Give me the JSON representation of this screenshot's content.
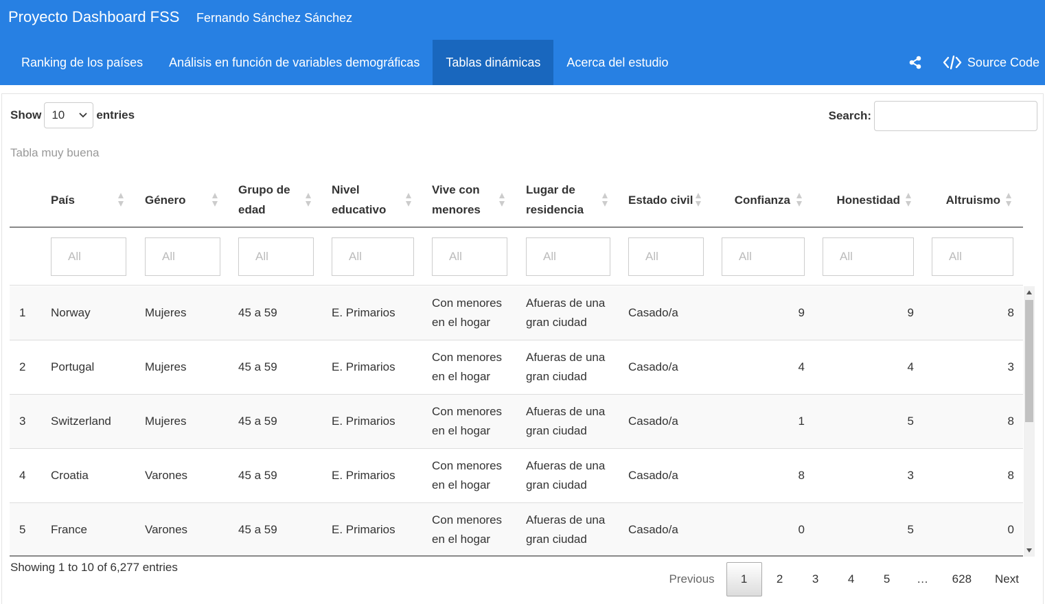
{
  "header": {
    "brand": "Proyecto Dashboard FSS",
    "author": "Fernando Sánchez Sánchez",
    "tabs": [
      {
        "label": "Ranking de los países",
        "active": false
      },
      {
        "label": "Análisis en función de variables demográficas",
        "active": false
      },
      {
        "label": "Tablas dinámicas",
        "active": true
      },
      {
        "label": "Acerca del estudio",
        "active": false
      }
    ],
    "source_code_label": "Source Code"
  },
  "controls": {
    "show_label": "Show",
    "entries_label": "entries",
    "page_length": "10",
    "search_label": "Search:",
    "search_value": ""
  },
  "caption": "Tabla muy buena",
  "table": {
    "columns": [
      "País",
      "Género",
      "Grupo de edad",
      "Nivel educativo",
      "Vive con menores",
      "Lugar de residencia",
      "Estado civil",
      "Confianza",
      "Honestidad",
      "Altruismo"
    ],
    "filter_placeholders": [
      "All",
      "All",
      "All",
      "All",
      "All",
      "All",
      "All",
      "All",
      "All",
      "All"
    ],
    "rows": [
      {
        "index": "1",
        "pais": "Norway",
        "genero": "Mujeres",
        "edad": "45 a 59",
        "nivel": "E. Primarios",
        "menores": "Con menores en el hogar",
        "residencia": "Afueras de una gran ciudad",
        "civil": "Casado/a",
        "confianza": "9",
        "honestidad": "9",
        "altruismo": "8"
      },
      {
        "index": "2",
        "pais": "Portugal",
        "genero": "Mujeres",
        "edad": "45 a 59",
        "nivel": "E. Primarios",
        "menores": "Con menores en el hogar",
        "residencia": "Afueras de una gran ciudad",
        "civil": "Casado/a",
        "confianza": "4",
        "honestidad": "4",
        "altruismo": "3"
      },
      {
        "index": "3",
        "pais": "Switzerland",
        "genero": "Mujeres",
        "edad": "45 a 59",
        "nivel": "E. Primarios",
        "menores": "Con menores en el hogar",
        "residencia": "Afueras de una gran ciudad",
        "civil": "Casado/a",
        "confianza": "1",
        "honestidad": "5",
        "altruismo": "8"
      },
      {
        "index": "4",
        "pais": "Croatia",
        "genero": "Varones",
        "edad": "45 a 59",
        "nivel": "E. Primarios",
        "menores": "Con menores en el hogar",
        "residencia": "Afueras de una gran ciudad",
        "civil": "Casado/a",
        "confianza": "8",
        "honestidad": "3",
        "altruismo": "8"
      },
      {
        "index": "5",
        "pais": "France",
        "genero": "Varones",
        "edad": "45 a 59",
        "nivel": "E. Primarios",
        "menores": "Con menores en el hogar",
        "residencia": "Afueras de una gran ciudad",
        "civil": "Casado/a",
        "confianza": "0",
        "honestidad": "5",
        "altruismo": "0"
      }
    ]
  },
  "footer": {
    "info": "Showing 1 to 10 of 6,277 entries",
    "previous": "Previous",
    "pages": [
      "1",
      "2",
      "3",
      "4",
      "5"
    ],
    "ellipsis": "…",
    "last_page": "628",
    "next": "Next",
    "current_page": "1"
  },
  "colors": {
    "navbar": "#2780e3",
    "active_tab": "#1967be"
  },
  "icons": {
    "share": "share-icon",
    "code": "code-icon",
    "sort": "sort-icon",
    "caret": "chevron-down-icon"
  }
}
